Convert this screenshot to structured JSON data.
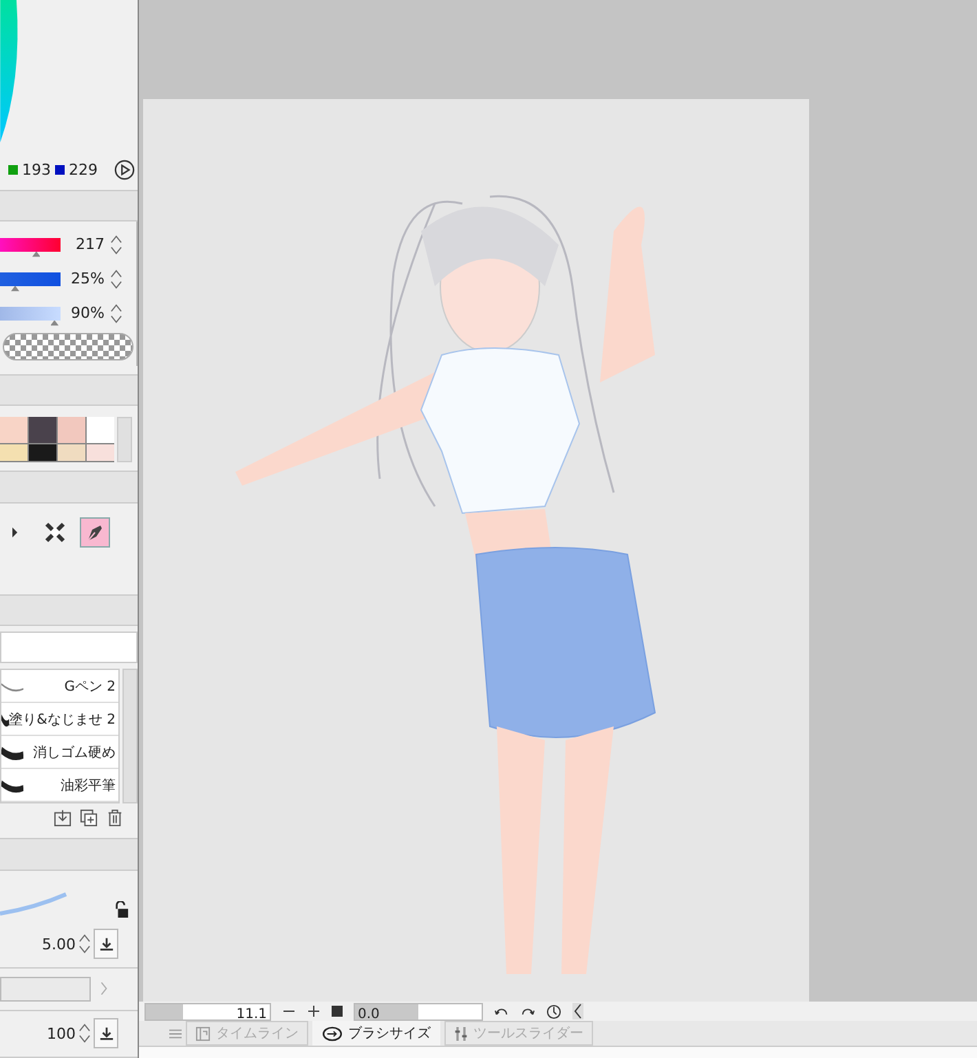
{
  "color_readout": {
    "green": "193",
    "blue": "229"
  },
  "color_sliders": [
    {
      "reading": "217",
      "kind": "hue",
      "level": 0.6
    },
    {
      "reading": "25%",
      "kind": "saturation",
      "level": 0.25
    },
    {
      "reading": "90%",
      "kind": "lightness",
      "level": 0.9
    }
  ],
  "swatches": [
    {
      "color": "#f8d4c6"
    },
    {
      "color": "#4a424c"
    },
    {
      "color": "#f2c8be"
    },
    {
      "color": "#ffffff"
    },
    {
      "color": "#f4e0b0"
    },
    {
      "color": "#1a1a1a"
    },
    {
      "color": "#f0dcc0"
    },
    {
      "color": "#f8e0dc"
    }
  ],
  "tools": [
    {
      "kind": "wand",
      "selected": false
    },
    {
      "kind": "cross",
      "selected": false
    },
    {
      "kind": "pen",
      "selected": true
    }
  ],
  "brushes": [
    {
      "name": "Gペン 2",
      "kind": "thin"
    },
    {
      "name": "塗り&なじませ 2",
      "kind": "wide"
    },
    {
      "name": "消しゴム硬め",
      "kind": "eraser"
    },
    {
      "name": "油彩平筆",
      "kind": "flat"
    }
  ],
  "brush_size": {
    "value": "5.00"
  },
  "opacity": {
    "value": "100"
  },
  "bottom_bar": {
    "zoom": {
      "reading": "11.1",
      "level": 0.3
    },
    "rotation": {
      "reading": "0.0",
      "level": 0.5
    }
  },
  "tabs": [
    {
      "label": "タイムライン",
      "kind": "timeline",
      "selected": false
    },
    {
      "label": "ブラシサイズ",
      "kind": "brush",
      "selected": true
    },
    {
      "label": "ツールスライダー",
      "kind": "slider",
      "selected": false
    }
  ]
}
